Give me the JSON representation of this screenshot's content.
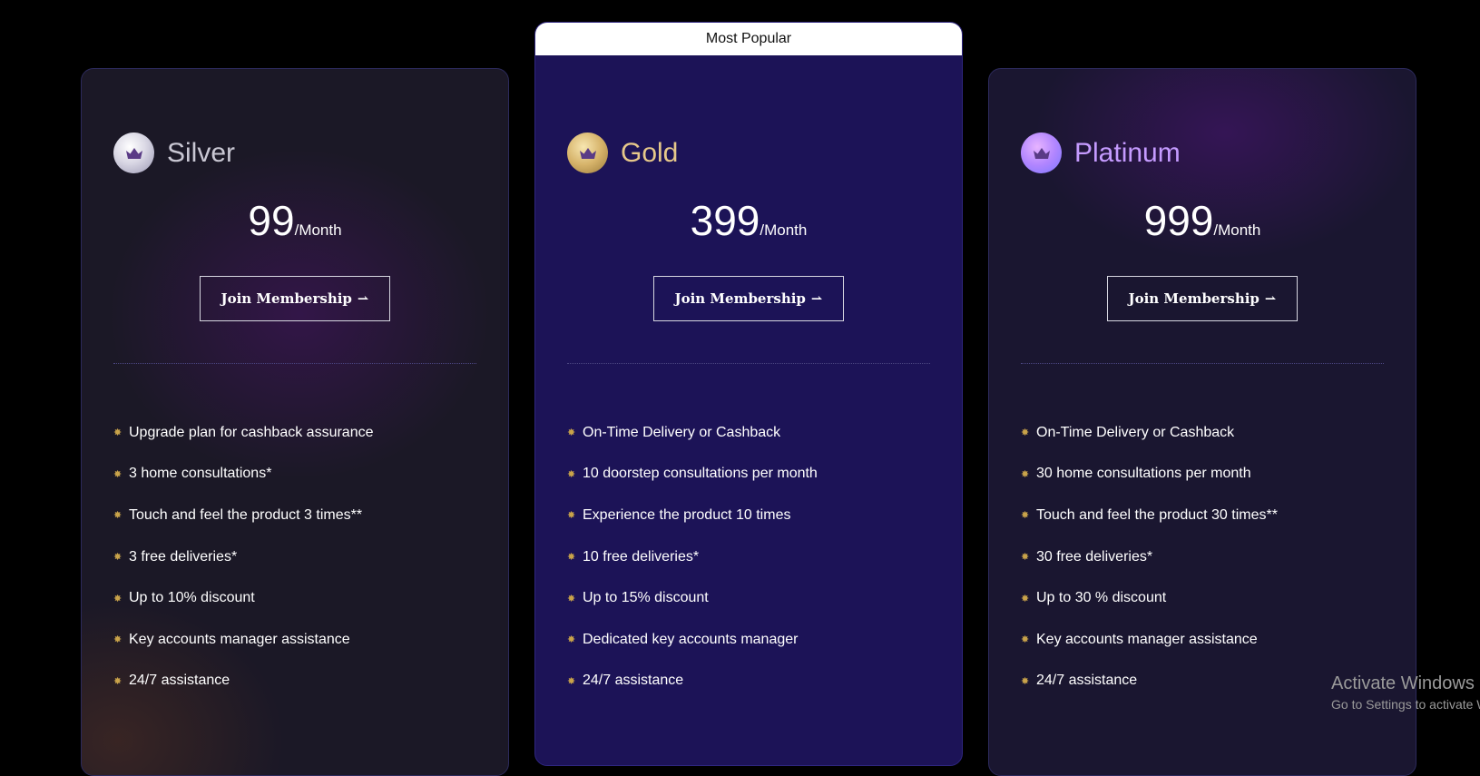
{
  "plans": [
    {
      "name": "Silver",
      "price": "99",
      "period": "/Month",
      "button_label": "Join Membership",
      "features": [
        "Upgrade plan for cashback assurance",
        "3 home consultations*",
        "Touch and feel the product 3 times**",
        "3 free deliveries*",
        "Up to 10% discount",
        "Key accounts manager assistance",
        "24/7 assistance"
      ]
    },
    {
      "name": "Gold",
      "badge": "Most Popular",
      "price": "399",
      "period": "/Month",
      "button_label": "Join Membership",
      "features": [
        "On-Time Delivery or Cashback",
        "10 doorstep consultations per month",
        "Experience the product 10 times",
        "10 free deliveries*",
        "Up to 15% discount",
        "Dedicated key accounts manager",
        "24/7 assistance"
      ]
    },
    {
      "name": "Platinum",
      "price": "999",
      "period": "/Month",
      "button_label": "Join Membership",
      "features": [
        "On-Time Delivery or Cashback",
        "30 home consultations per month",
        "Touch and feel the product 30 times**",
        "30 free deliveries*",
        "Up to 30 % discount",
        "Key accounts manager assistance",
        "24/7 assistance"
      ]
    }
  ],
  "icons": {
    "plan": "crown-icon",
    "feature": "star-icon",
    "button": "arrow-icon"
  },
  "colors": {
    "page_bg": "#000000",
    "gold_card_bg": "#1c1357",
    "silver_name": "#c9c7d3",
    "gold_name": "#e6c88a",
    "platinum_name": "#c59bff",
    "feature_star": "#c9a34a"
  },
  "watermark": {
    "title": "Activate Windows",
    "subtitle": "Go to Settings to activate Windows."
  }
}
